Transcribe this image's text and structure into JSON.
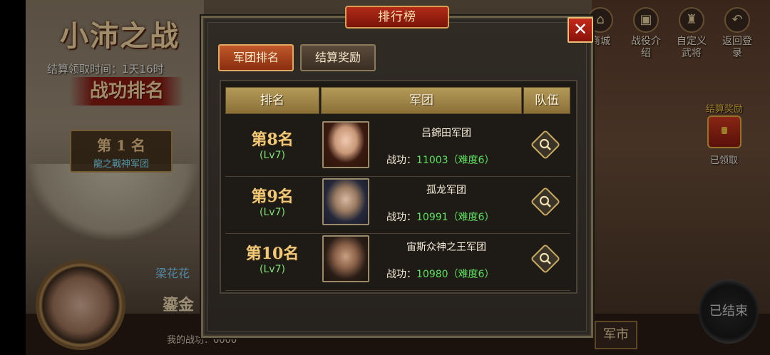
{
  "background": {
    "event_title": "小沛之战",
    "settle_time": "结算领取时间：1天16时",
    "rank_heading": "战功排名",
    "first_place": {
      "rank": "第 1 名",
      "legion": "龍之戰神军团"
    },
    "player_name": "梁花花",
    "mine_name": "鎏金",
    "my_merit": "我的战功：0000",
    "top_icons": [
      {
        "icon": "shop-icon",
        "label": "商城"
      },
      {
        "icon": "battle-info-icon",
        "label": "战役介绍"
      },
      {
        "icon": "custom-general-icon",
        "label": "自定义武将"
      },
      {
        "icon": "return-icon",
        "label": "返回登录"
      }
    ],
    "reward_label": "结算奖励",
    "claimed_label": "已领取",
    "ended_label": "已结束",
    "market_label": "军市"
  },
  "dialog": {
    "title": "排行榜",
    "close_glyph": "✕",
    "tabs": [
      {
        "label": "军团排名",
        "active": true
      },
      {
        "label": "结算奖励",
        "active": false
      }
    ],
    "headers": {
      "rank": "排名",
      "legion": "军团",
      "team": "队伍"
    },
    "rows": [
      {
        "rank": "第8名",
        "level": "(Lv7)",
        "legion": "吕錦田军团",
        "merit_label": "战功：",
        "merit_value": "11003（难度6）"
      },
      {
        "rank": "第9名",
        "level": "(Lv7)",
        "legion": "孤龙军团",
        "merit_label": "战功：",
        "merit_value": "10991（难度6）"
      },
      {
        "rank": "第10名",
        "level": "(Lv7)",
        "legion": "宙斯众神之王军团",
        "merit_label": "战功：",
        "merit_value": "10980（难度6）"
      }
    ]
  },
  "colors": {
    "tab_active": "#c0582a",
    "header_gold": "#b49a58",
    "rank_gold": "#f0c878",
    "level_green": "#7ee070",
    "merit_green": "#5ee05e",
    "close_red": "#c42a1c"
  }
}
